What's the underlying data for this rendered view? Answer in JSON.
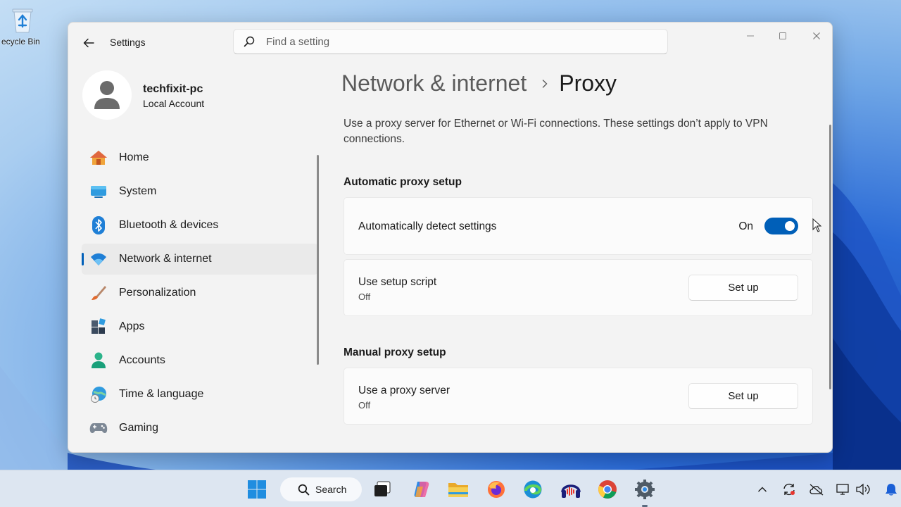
{
  "desktop": {
    "recycle_bin_label": "ecycle Bin"
  },
  "window": {
    "app_title": "Settings",
    "search": {
      "placeholder": "Find a setting"
    }
  },
  "profile": {
    "name": "techfixit-pc",
    "account_type": "Local Account"
  },
  "nav": {
    "items": [
      {
        "label": "Home",
        "icon": "home-icon",
        "active": false
      },
      {
        "label": "System",
        "icon": "system-icon",
        "active": false
      },
      {
        "label": "Bluetooth & devices",
        "icon": "bluetooth-icon",
        "active": false
      },
      {
        "label": "Network & internet",
        "icon": "wifi-icon",
        "active": true
      },
      {
        "label": "Personalization",
        "icon": "brush-icon",
        "active": false
      },
      {
        "label": "Apps",
        "icon": "apps-icon",
        "active": false
      },
      {
        "label": "Accounts",
        "icon": "accounts-icon",
        "active": false
      },
      {
        "label": "Time & language",
        "icon": "time-language-icon",
        "active": false
      },
      {
        "label": "Gaming",
        "icon": "gaming-icon",
        "active": false
      }
    ]
  },
  "content": {
    "breadcrumb_parent": "Network & internet",
    "breadcrumb_current": "Proxy",
    "description": "Use a proxy server for Ethernet or Wi-Fi connections. These settings don’t apply to VPN connections.",
    "auto_section": {
      "title": "Automatic proxy setup",
      "detect": {
        "label": "Automatically detect settings",
        "state": "On"
      },
      "script": {
        "label": "Use setup script",
        "status": "Off",
        "button": "Set up"
      }
    },
    "manual_section": {
      "title": "Manual proxy setup",
      "proxy": {
        "label": "Use a proxy server",
        "status": "Off",
        "button": "Set up"
      }
    }
  },
  "taskbar": {
    "search_label": "Search"
  },
  "colors": {
    "accent": "#005fb8",
    "window_bg": "#f3f3f3",
    "card_bg": "#fbfbfb"
  }
}
